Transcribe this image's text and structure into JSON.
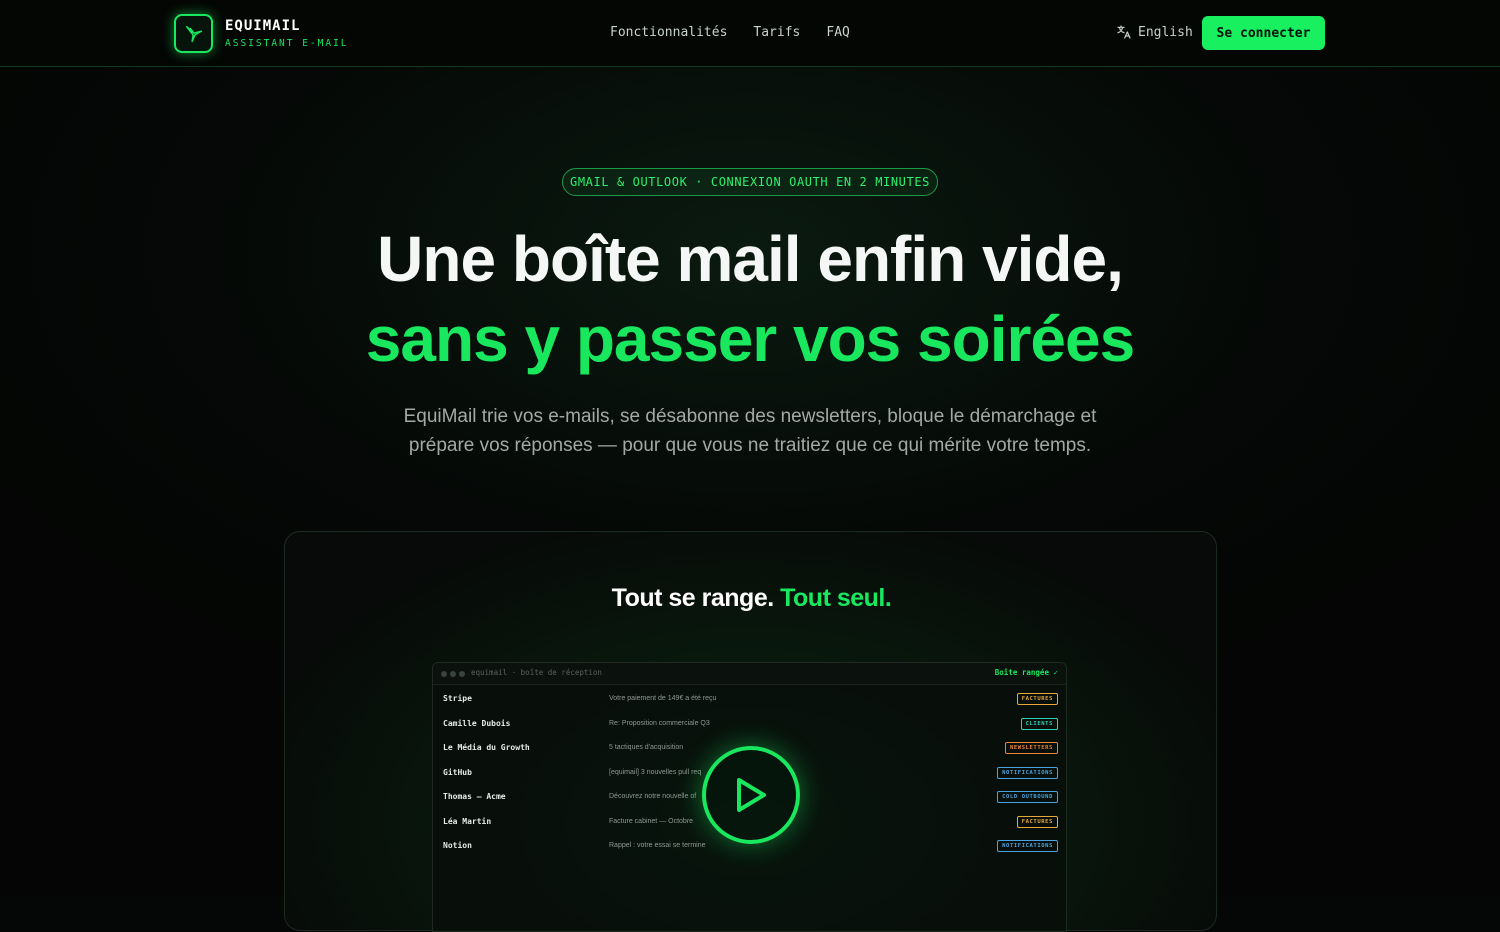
{
  "nav": {
    "brand": "EQUIMAIL",
    "brand_sub": "ASSISTANT E-MAIL",
    "links": [
      "Fonctionnalités",
      "Tarifs",
      "FAQ"
    ],
    "language": "English",
    "login": "Se connecter"
  },
  "hero": {
    "pill": "GMAIL & OUTLOOK · CONNEXION OAUTH EN 2 MINUTES",
    "title_line1": "Une boîte mail enfin vide,",
    "title_line2": "sans y passer vos soirées",
    "lead": "EquiMail trie vos e-mails, se désabonne des newsletters, bloque le démarchage et prépare vos réponses — pour que vous ne traitiez que ce qui mérite votre temps."
  },
  "demo": {
    "title_white": "Tout se range.",
    "title_green": "Tout seul.",
    "inbox_path": "equimail · boîte de réception",
    "inbox_status": "Boîte rangée ✓",
    "rows": [
      {
        "sender": "Stripe",
        "subject": "Votre paiement de 149€ a été reçu",
        "tag": "FACTURES",
        "color": "#e8a93a"
      },
      {
        "sender": "Camille Dubois",
        "subject": "Re: Proposition commerciale Q3",
        "tag": "CLIENTS",
        "color": "#2fd0b8"
      },
      {
        "sender": "Le Média du Growth",
        "subject": "5 tactiques d'acquisition",
        "tag": "NEWSLETTERS",
        "color": "#e8843a"
      },
      {
        "sender": "GitHub",
        "subject": "[equimail] 3 nouvelles pull req",
        "tag": "NOTIFICATIONS",
        "color": "#4aa3e0"
      },
      {
        "sender": "Thomas — Acme",
        "subject": "Découvrez notre nouvelle of",
        "tag": "COLD OUTBOUND",
        "color": "#4aa3e0"
      },
      {
        "sender": "Léa Martin",
        "subject": "Facture cabinet — Octobre",
        "tag": "FACTURES",
        "color": "#e8a93a"
      },
      {
        "sender": "Notion",
        "subject": "Rappel : votre essai se termine",
        "tag": "NOTIFICATIONS",
        "color": "#4aa3e0"
      }
    ]
  },
  "colors": {
    "accent": "#19e85f",
    "background": "#050706"
  },
  "icons": {
    "logo": "hummingbird-icon",
    "language": "translate-icon",
    "play": "play-icon"
  }
}
